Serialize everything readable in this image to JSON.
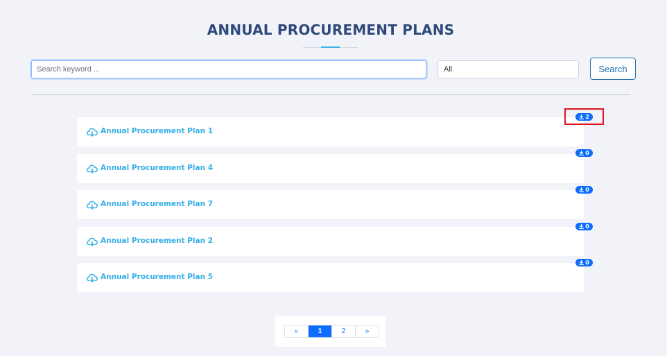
{
  "header": {
    "title": "ANNUAL PROCUREMENT PLANS"
  },
  "search": {
    "placeholder": "Search keyword ...",
    "value": "",
    "filter_selected": "All",
    "button_label": "Search"
  },
  "plans": [
    {
      "label": "Annual Procurement Plan 1",
      "downloads": "2"
    },
    {
      "label": "Annual Procurement Plan 4",
      "downloads": "0"
    },
    {
      "label": "Annual Procurement Plan 7",
      "downloads": "0"
    },
    {
      "label": "Annual Procurement Plan 2",
      "downloads": "0"
    },
    {
      "label": "Annual Procurement Plan 5",
      "downloads": "0"
    }
  ],
  "pagination": {
    "prev_label": "«",
    "pages": [
      "1",
      "2"
    ],
    "active_page": "1",
    "next_label": "»"
  },
  "icons": {
    "plan_icon": "cloud-download-icon",
    "badge_icon": "download-icon"
  },
  "colors": {
    "accent": "#35aee6",
    "primary": "#0d6efd",
    "title": "#2f4a7a",
    "highlight": "#e0141e",
    "background": "#f1f3f9"
  }
}
